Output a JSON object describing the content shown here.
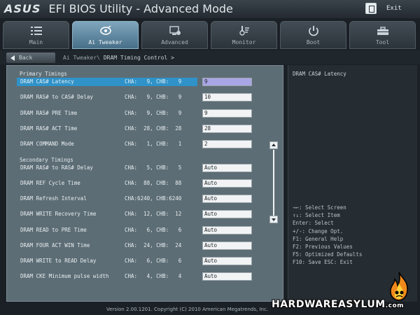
{
  "window": {
    "brand": "ASUS",
    "title": "EFI BIOS Utility - Advanced Mode",
    "exit_label": "Exit"
  },
  "tabs": [
    {
      "label": "Main",
      "icon": "list-icon",
      "active": false
    },
    {
      "label": "Ai Tweaker",
      "icon": "ai-tweaker-icon",
      "active": true
    },
    {
      "label": "Advanced",
      "icon": "advanced-icon",
      "active": false
    },
    {
      "label": "Monitor",
      "icon": "monitor-icon",
      "active": false
    },
    {
      "label": "Boot",
      "icon": "power-icon",
      "active": false
    },
    {
      "label": "Tool",
      "icon": "toolbox-icon",
      "active": false
    }
  ],
  "nav": {
    "back_label": "Back",
    "breadcrumb_root": "Ai Tweaker\\",
    "breadcrumb_current": "DRAM Timing Control >"
  },
  "sections": {
    "primary": "Primary Timings",
    "secondary": "Secondary Timings"
  },
  "timings": [
    {
      "name": "DRAM CAS# Latency",
      "cha": "CHA:   9, CHB:   9",
      "value": "9",
      "selected": true
    },
    {
      "name": "DRAM RAS# to CAS# Delay",
      "cha": "CHA:   9, CHB:   9",
      "value": "10"
    },
    {
      "name": "DRAM RAS# PRE Time",
      "cha": "CHA:   9, CHB:   9",
      "value": "9"
    },
    {
      "name": "DRAM RAS# ACT Time",
      "cha": "CHA:  28, CHB:  28",
      "value": "28"
    },
    {
      "name": "DRAM COMMAND Mode",
      "cha": "CHA:   1, CHB:   1",
      "value": "2"
    },
    {
      "name": "DRAM RAS# to RAS# Delay",
      "cha": "CHA:   5, CHB:   5",
      "value": "Auto"
    },
    {
      "name": "DRAM REF Cycle Time",
      "cha": "CHA:  88, CHB:  88",
      "value": "Auto"
    },
    {
      "name": "DRAM Refresh Interval",
      "cha": "CHA:6240, CHB:6240",
      "value": "Auto"
    },
    {
      "name": "DRAM WRITE Recovery Time",
      "cha": "CHA:  12, CHB:  12",
      "value": "Auto"
    },
    {
      "name": "DRAM READ to PRE Time",
      "cha": "CHA:   6, CHB:   6",
      "value": "Auto"
    },
    {
      "name": "DRAM FOUR ACT WIN Time",
      "cha": "CHA:  24, CHB:  24",
      "value": "Auto"
    },
    {
      "name": "DRAM WRITE to READ Delay",
      "cha": "CHA:   6, CHB:   6",
      "value": "Auto"
    },
    {
      "name": "DRAM CKE Minimum pulse width",
      "cha": "CHA:   4, CHB:   4",
      "value": "Auto"
    }
  ],
  "help": {
    "description": "DRAM CAS# Latency",
    "keys": [
      "→←: Select Screen",
      "↑↓: Select Item",
      "Enter: Select",
      "+/-: Change Opt.",
      "F1: General Help",
      "F2: Previous Values",
      "F5: Optimized Defaults",
      "F10: Save  ESC: Exit"
    ]
  },
  "footer": {
    "copyright": "Version 2.00.1201. Copyright (C) 2010 American Megatrends, Inc."
  },
  "watermark": {
    "text": "HARDWAREASYLUM",
    "suffix": ".com"
  },
  "colors": {
    "accent": "#2f93c9",
    "active_tab": "#6b93ab",
    "panel": "#5d6d75",
    "selected_value": "#a9a6e6"
  }
}
